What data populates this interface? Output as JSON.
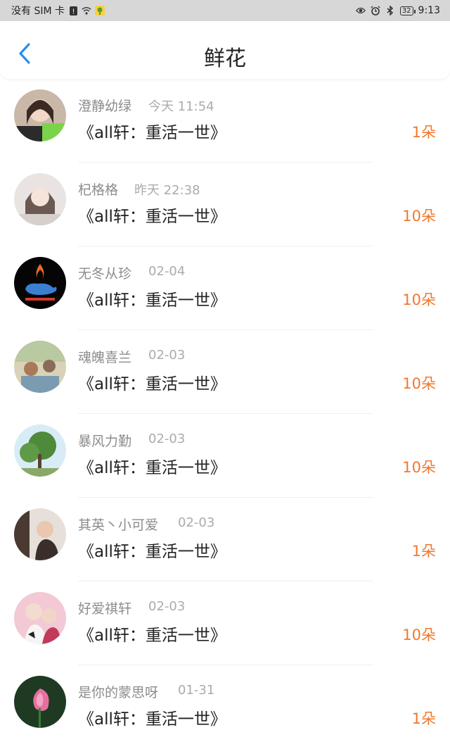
{
  "status_bar": {
    "carrier": "没有 SIM 卡",
    "alert_icon": "!",
    "battery": "32",
    "time": "9:13"
  },
  "header": {
    "title": "鲜花",
    "back_icon": "chevron-left-icon"
  },
  "accent_color": "#f0782d",
  "records": [
    {
      "name": "澄静幼绿",
      "time": "今天 11:54",
      "book": "《all轩：重活一世》",
      "count": "1朵"
    },
    {
      "name": "杞格格",
      "time": "昨天 22:38",
      "book": "《all轩：重活一世》",
      "count": "10朵"
    },
    {
      "name": "无冬从珍",
      "time": "02-04",
      "book": "《all轩：重活一世》",
      "count": "10朵"
    },
    {
      "name": "魂魄喜兰",
      "time": "02-03",
      "book": "《all轩：重活一世》",
      "count": "10朵"
    },
    {
      "name": "暴风力勤",
      "time": "02-03",
      "book": "《all轩：重活一世》",
      "count": "10朵"
    },
    {
      "name": "其英丶小可爱",
      "time": "02-03",
      "book": "《all轩：重活一世》",
      "count": "1朵"
    },
    {
      "name": "好爱祺轩",
      "time": "02-03",
      "book": "《all轩：重活一世》",
      "count": "10朵"
    },
    {
      "name": "是你的蒙思呀",
      "time": "01-31",
      "book": "《all轩：重活一世》",
      "count": "1朵"
    }
  ]
}
